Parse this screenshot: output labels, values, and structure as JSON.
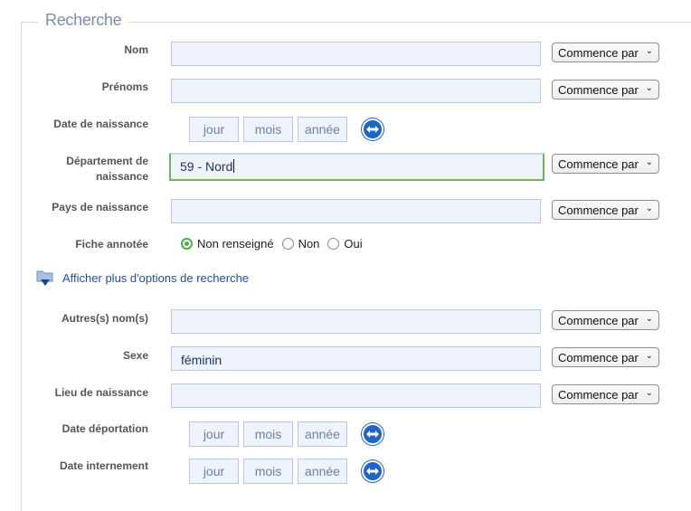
{
  "fieldset": {
    "legend": "Recherche"
  },
  "select_default": "Commence par",
  "date_placeholders": {
    "day": "jour",
    "month": "mois",
    "year": "année"
  },
  "fields": {
    "nom": {
      "label": "Nom",
      "value": ""
    },
    "prenoms": {
      "label": "Prénoms",
      "value": ""
    },
    "date_naissance": {
      "label": "Date de naissance"
    },
    "departement": {
      "label_line1": "Département de",
      "label_line2": "naissance",
      "value": "59 - Nord"
    },
    "pays": {
      "label": "Pays de naissance",
      "value": ""
    },
    "fiche": {
      "label": "Fiche annotée",
      "options": [
        "Non renseigné",
        "Non",
        "Oui"
      ],
      "selected": "Non renseigné"
    },
    "autres_noms": {
      "label": "Autres(s) nom(s)",
      "value": ""
    },
    "sexe": {
      "label": "Sexe",
      "value": "féminin"
    },
    "lieu": {
      "label": "Lieu de naissance",
      "value": ""
    },
    "date_deportation": {
      "label": "Date déportation"
    },
    "date_internement": {
      "label": "Date internement"
    }
  },
  "more_options": {
    "label": "Afficher plus d'options de recherche",
    "icon": "folder-down-icon"
  },
  "icons": {
    "swap": "swap-arrows-icon",
    "chevron": "chevron-down-icon"
  },
  "colors": {
    "accent": "#1f64c8",
    "focus": "#6bb656",
    "input_bg": "#eef3fc",
    "link": "#1f4fa8"
  }
}
